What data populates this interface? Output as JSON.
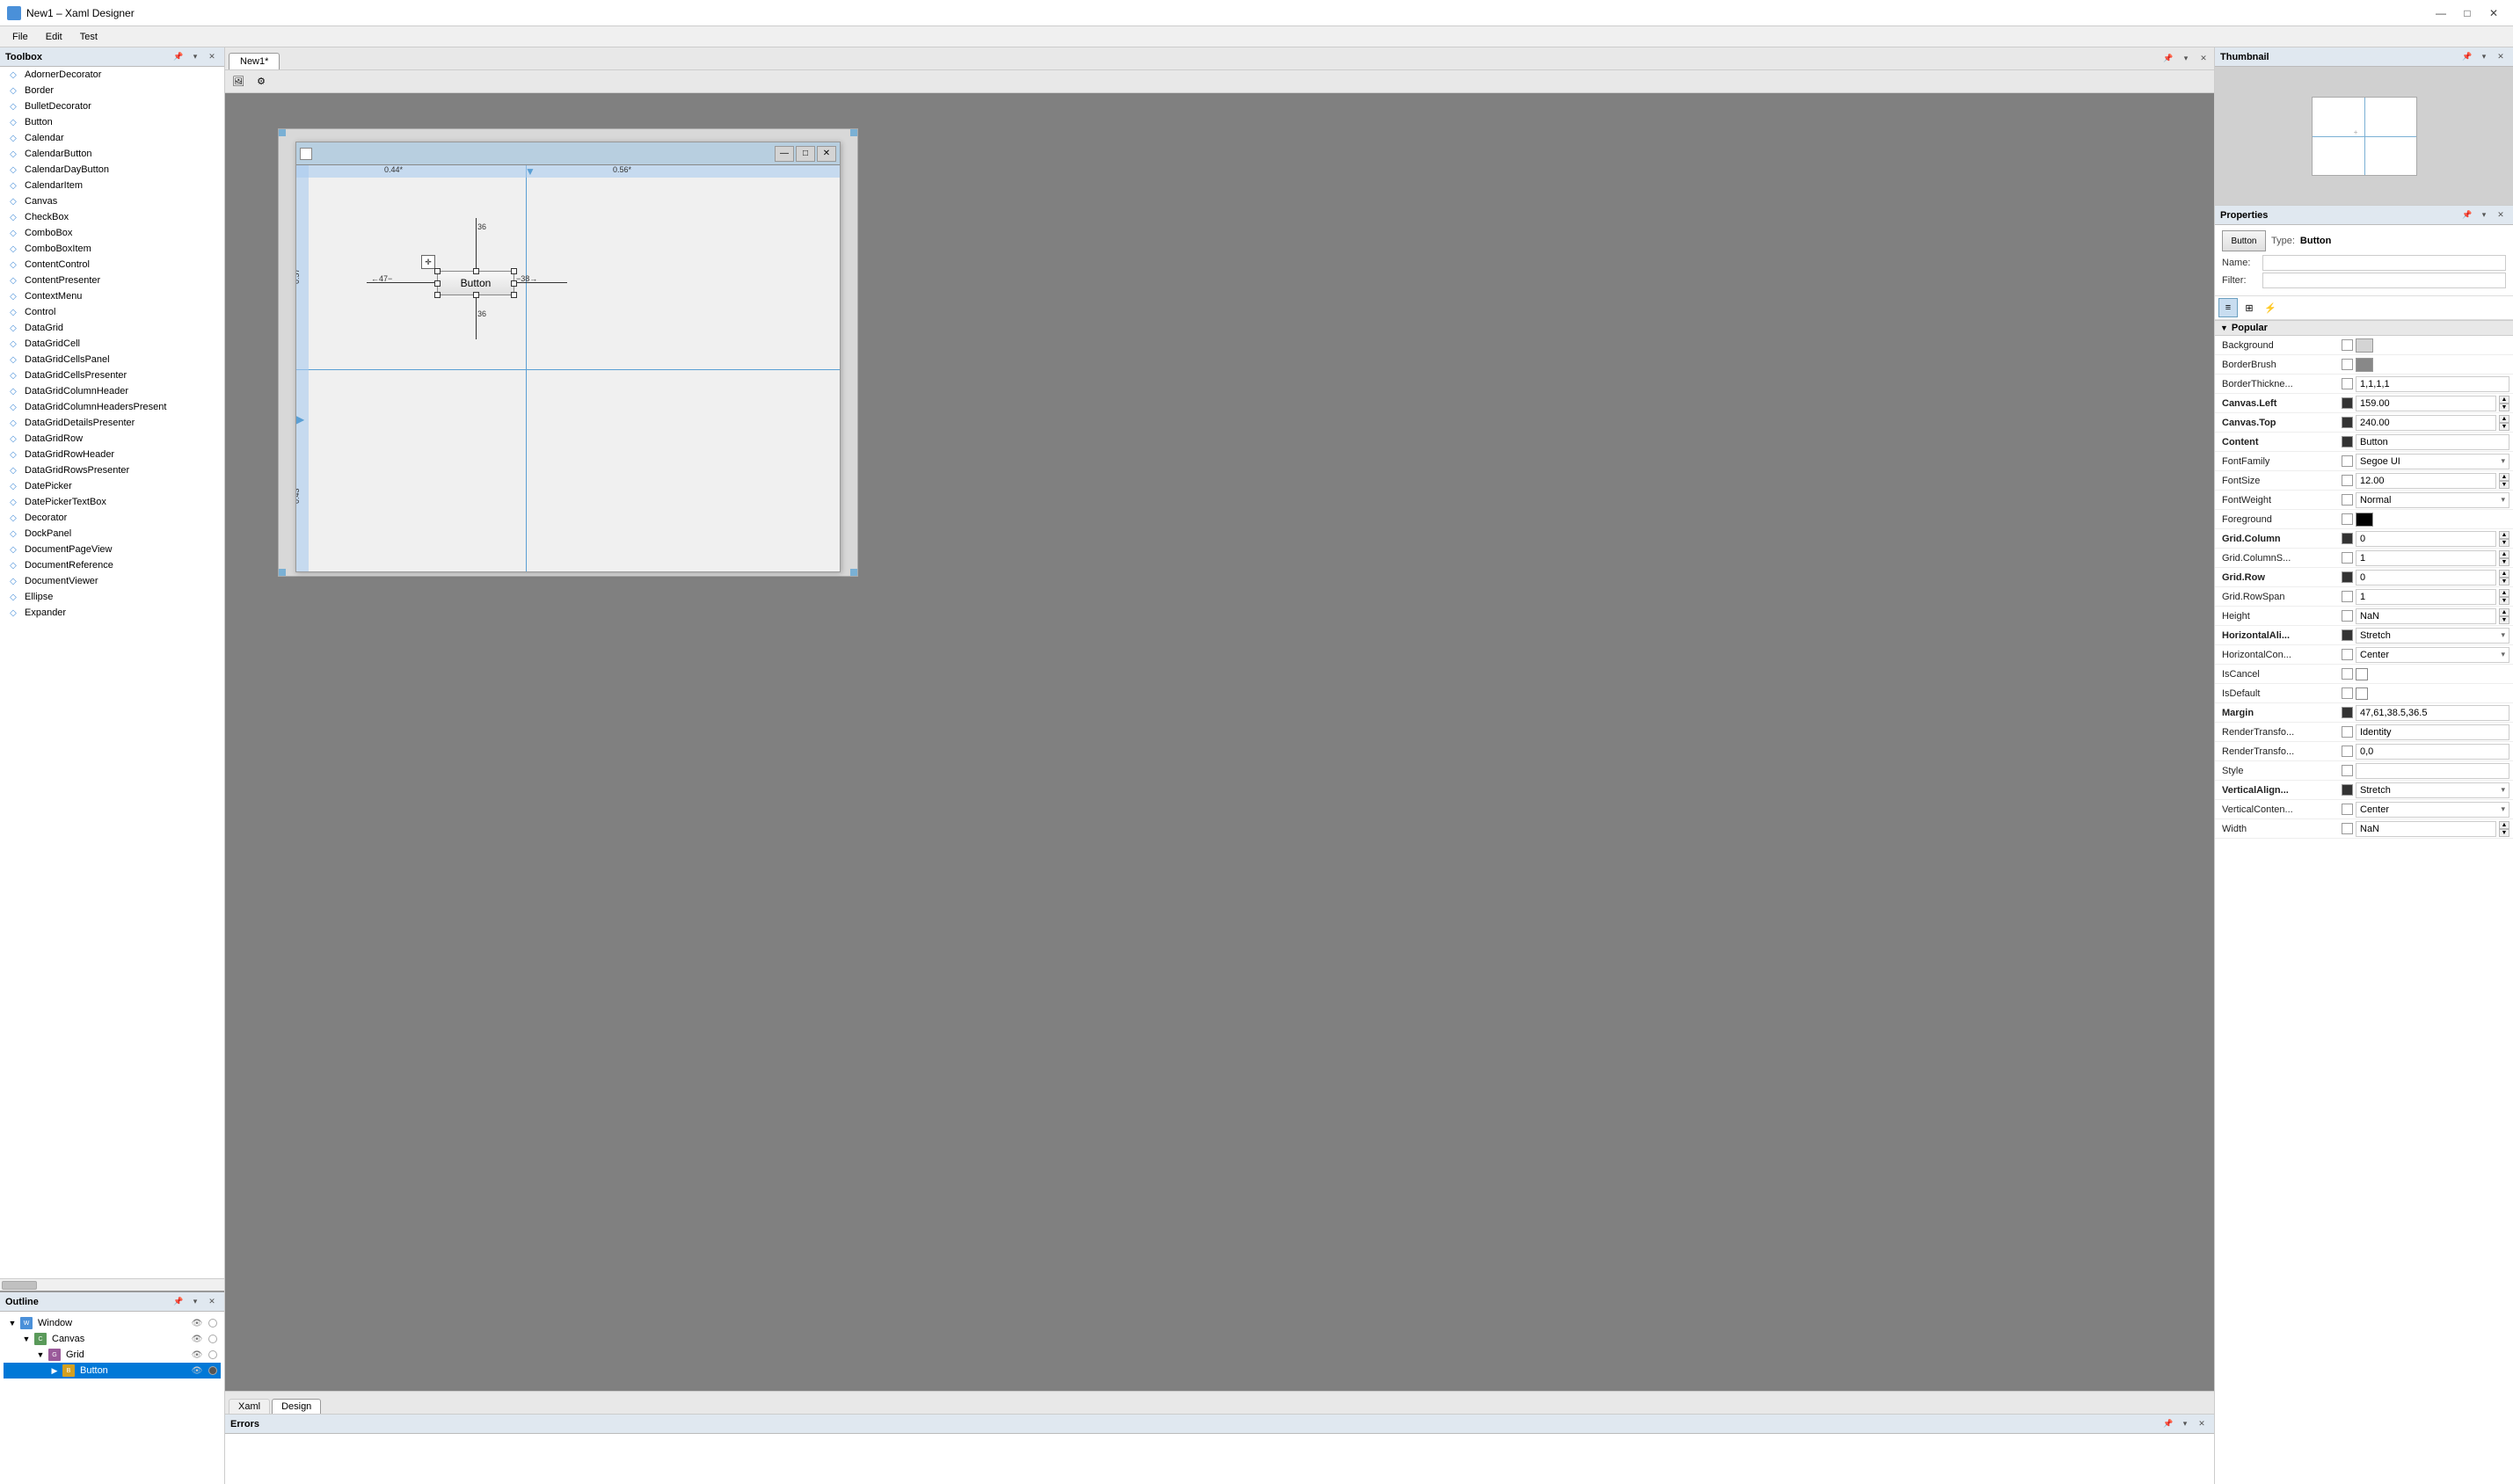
{
  "titleBar": {
    "title": "New1 – Xaml Designer",
    "icon": "xaml-icon",
    "controls": {
      "minimize": "—",
      "maximize": "□",
      "close": "✕"
    }
  },
  "menuBar": {
    "items": [
      "File",
      "Edit",
      "Test"
    ]
  },
  "toolbox": {
    "title": "Toolbox",
    "items": [
      "AdornerDecorator",
      "Border",
      "BulletDecorator",
      "Button",
      "Calendar",
      "CalendarButton",
      "CalendarDayButton",
      "CalendarItem",
      "Canvas",
      "CheckBox",
      "ComboBox",
      "ComboBoxItem",
      "ContentControl",
      "ContentPresenter",
      "ContextMenu",
      "Control",
      "DataGrid",
      "DataGridCell",
      "DataGridCellsPanel",
      "DataGridCellsPresenter",
      "DataGridColumnHeader",
      "DataGridColumnHeadersPresent",
      "DataGridDetailsPresenter",
      "DataGridRow",
      "DataGridRowHeader",
      "DataGridRowsPresenter",
      "DatePicker",
      "DatePickerTextBox",
      "Decorator",
      "DockPanel",
      "DocumentPageView",
      "DocumentReference",
      "DocumentViewer",
      "Ellipse",
      "Expander"
    ]
  },
  "designer": {
    "tabs": [
      "New1*"
    ],
    "activeTab": "New1*",
    "bottomTabs": [
      "Xaml",
      "Design"
    ],
    "activeBottomTab": "Design",
    "canvas": {
      "gridCols": [
        "0.44*",
        "0.56*"
      ],
      "gridRows": [
        "0.57*",
        "0.43*"
      ],
      "button": {
        "label": "Button",
        "left": "−47−",
        "right": "−38−",
        "top": "36",
        "bottom": "36"
      }
    }
  },
  "errors": {
    "title": "Errors",
    "items": []
  },
  "outline": {
    "title": "Outline",
    "tree": [
      {
        "label": "Window",
        "type": "window",
        "level": 0,
        "expanded": true,
        "eye": true,
        "dot": false
      },
      {
        "label": "Canvas",
        "type": "canvas",
        "level": 1,
        "expanded": true,
        "eye": true,
        "dot": false
      },
      {
        "label": "Grid",
        "type": "grid",
        "level": 2,
        "expanded": true,
        "eye": true,
        "dot": false
      },
      {
        "label": "Button",
        "type": "button",
        "level": 3,
        "expanded": false,
        "eye": true,
        "dot": true,
        "selected": true
      }
    ]
  },
  "thumbnail": {
    "title": "Thumbnail"
  },
  "properties": {
    "title": "Properties",
    "type": "Button",
    "typeLabel": "Type:",
    "nameLabel": "Name:",
    "filterLabel": "Filter:",
    "buttonPreviewLabel": "Button",
    "sections": [
      {
        "name": "Popular",
        "expanded": true,
        "props": [
          {
            "name": "Background",
            "bold": false,
            "checkbox": true,
            "hasColor": true,
            "colorLight": "#d4d4d4",
            "value": ""
          },
          {
            "name": "BorderBrush",
            "bold": false,
            "checkbox": true,
            "hasColor": true,
            "colorDark": "#888",
            "value": ""
          },
          {
            "name": "BorderThickne...",
            "bold": false,
            "checkbox": false,
            "value": "1,1,1,1",
            "hasSpinner": false
          },
          {
            "name": "Canvas.Left",
            "bold": true,
            "checkbox": false,
            "value": "159.00",
            "hasSpinner": true
          },
          {
            "name": "Canvas.Top",
            "bold": true,
            "checkbox": false,
            "value": "240.00",
            "hasSpinner": true
          },
          {
            "name": "Content",
            "bold": true,
            "checkbox": false,
            "value": "Button",
            "hasSpinner": false
          },
          {
            "name": "FontFamily",
            "bold": false,
            "checkbox": true,
            "dropdown": "Segoe UI",
            "hasSpinner": false
          },
          {
            "name": "FontSize",
            "bold": false,
            "checkbox": true,
            "value": "12.00",
            "hasSpinner": true
          },
          {
            "name": "FontWeight",
            "bold": false,
            "checkbox": true,
            "dropdown": "Normal",
            "hasSpinner": false
          },
          {
            "name": "Foreground",
            "bold": false,
            "checkbox": true,
            "hasColor": true,
            "colorBlack": "#000",
            "value": ""
          },
          {
            "name": "Grid.Column",
            "bold": true,
            "checkbox": false,
            "value": "0",
            "hasSpinner": true
          },
          {
            "name": "Grid.ColumnS...",
            "bold": false,
            "checkbox": false,
            "value": "1",
            "hasSpinner": true
          },
          {
            "name": "Grid.Row",
            "bold": true,
            "checkbox": false,
            "value": "0",
            "hasSpinner": true
          },
          {
            "name": "Grid.RowSpan",
            "bold": false,
            "checkbox": false,
            "value": "1",
            "hasSpinner": true
          },
          {
            "name": "Height",
            "bold": false,
            "checkbox": true,
            "value": "NaN",
            "hasSpinner": true
          },
          {
            "name": "HorizontalAli...",
            "bold": true,
            "checkbox": false,
            "dropdown": "Stretch",
            "hasSpinner": false
          },
          {
            "name": "HorizontalCon...",
            "bold": false,
            "checkbox": true,
            "dropdown": "Center",
            "hasSpinner": false
          },
          {
            "name": "IsCancel",
            "bold": false,
            "checkbox": true,
            "hasCheck2": true
          },
          {
            "name": "IsDefault",
            "bold": false,
            "checkbox": true,
            "hasCheck2": true
          },
          {
            "name": "Margin",
            "bold": true,
            "checkbox": false,
            "value": "47,61,38.5,36.5",
            "hasSpinner": false
          },
          {
            "name": "RenderTransfo...",
            "bold": false,
            "checkbox": true,
            "value": "Identity",
            "hasSpinner": false
          },
          {
            "name": "RenderTransfo...",
            "bold": false,
            "checkbox": true,
            "value": "0,0",
            "hasSpinner": false
          },
          {
            "name": "Style",
            "bold": false,
            "checkbox": true,
            "value": "",
            "hasSpinner": false
          },
          {
            "name": "VerticalAlign...",
            "bold": true,
            "checkbox": false,
            "dropdown": "Stretch",
            "hasSpinner": false
          },
          {
            "name": "VerticalConten...",
            "bold": false,
            "checkbox": true,
            "dropdown": "Center",
            "hasSpinner": false
          },
          {
            "name": "Width",
            "bold": false,
            "checkbox": true,
            "value": "NaN",
            "hasSpinner": true
          }
        ]
      }
    ],
    "toolbarButtons": [
      {
        "name": "category-view",
        "label": "≡",
        "active": true
      },
      {
        "name": "property-view",
        "label": "⊞",
        "active": false
      },
      {
        "name": "event-view",
        "label": "⚡",
        "active": false
      }
    ]
  }
}
